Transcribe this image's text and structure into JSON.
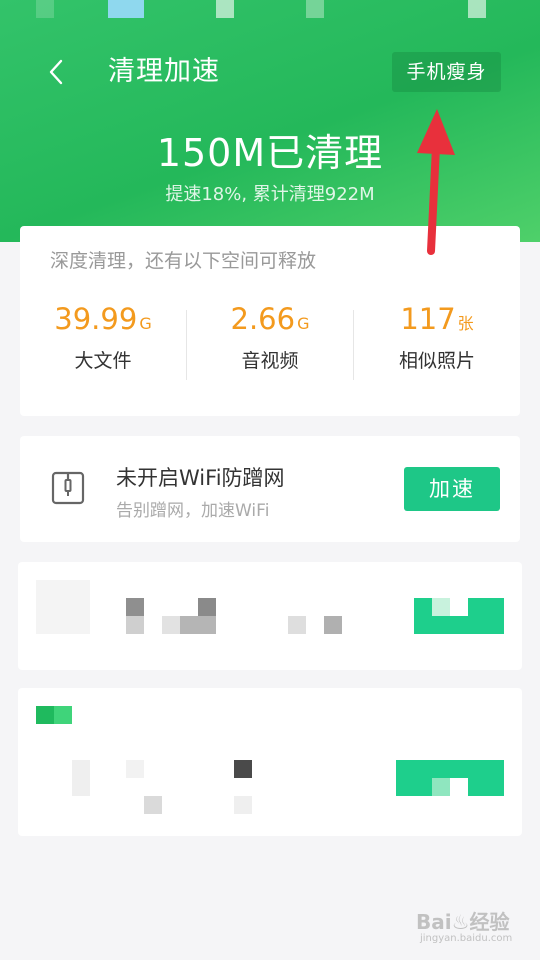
{
  "header": {
    "title": "清理加速",
    "slim_button_label": "手机瘦身",
    "cleaned_headline": "150M已清理",
    "cleaned_sub": "提速18%, 累计清理922M"
  },
  "deep_clean": {
    "title": "深度清理，还有以下空间可释放",
    "stats": [
      {
        "value": "39.99",
        "unit": "G",
        "label": "大文件"
      },
      {
        "value": "2.66",
        "unit": "G",
        "label": "音视频"
      },
      {
        "value": "117",
        "unit": "张",
        "label": "相似照片"
      }
    ]
  },
  "wifi_card": {
    "title": "未开启WiFi防蹭网",
    "subtitle": "告别蹭网，加速WiFi",
    "button_label": "加速"
  },
  "watermark": {
    "main": "Bai♨经验",
    "sub": "jingyan.baidu.com"
  },
  "colors": {
    "header_green": "#2fc064",
    "accent_orange": "#f39a1e",
    "button_green": "#1ec787",
    "annotation_red": "#e8303c"
  },
  "icons": {
    "back": "chevron-left-icon",
    "wifi_card": "device-frame-icon"
  }
}
